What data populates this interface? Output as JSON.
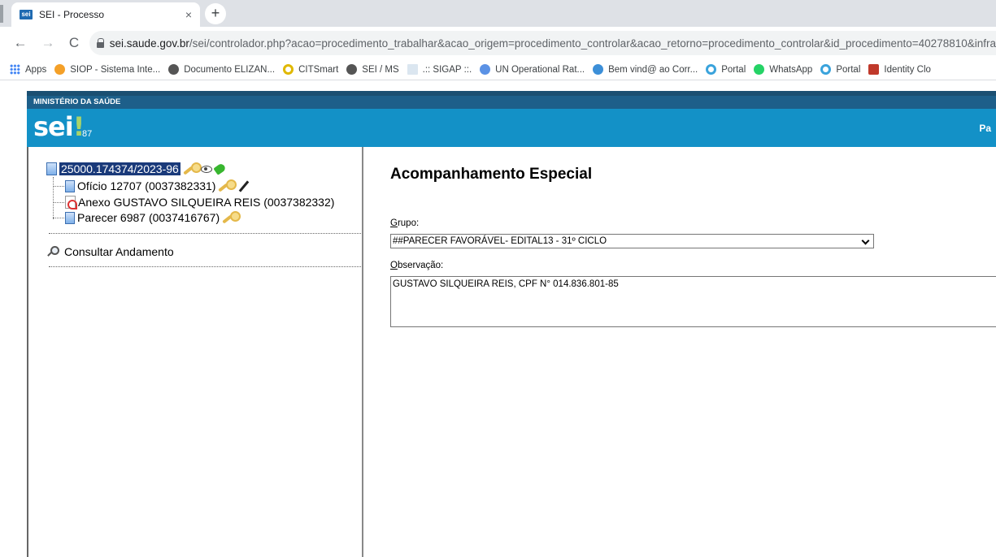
{
  "browser": {
    "tab_title": "SEI - Processo",
    "tab_favicon_text": "sei",
    "tab_close": "×",
    "new_tab": "+",
    "url_host": "sei.saude.gov.br",
    "url_path": "/sei/controlador.php?acao=procedimento_trabalhar&acao_origem=procedimento_controlar&acao_retorno=procedimento_controlar&id_procedimento=40278810&infra",
    "nav_back": "←",
    "nav_forward": "→",
    "nav_reload": "C"
  },
  "bookmarks": [
    {
      "label": "Apps",
      "color": "#4285f4"
    },
    {
      "label": "SIOP - Sistema Inte...",
      "color": "#f4a028"
    },
    {
      "label": "Documento ELIZAN...",
      "color": "#555555"
    },
    {
      "label": "CITSmart",
      "color": "#e0b800"
    },
    {
      "label": "SEI / MS",
      "color": "#555555"
    },
    {
      "label": ".:: SIGAP ::.",
      "color": "#9ab3cc"
    },
    {
      "label": "UN Operational Rat...",
      "color": "#5b92e5"
    },
    {
      "label": "Bem vind@ ao Corr...",
      "color": "#3c8fd8"
    },
    {
      "label": "Portal",
      "color": "#3aa3dc"
    },
    {
      "label": "WhatsApp",
      "color": "#25d366"
    },
    {
      "label": "Portal",
      "color": "#3aa3dc"
    },
    {
      "label": "Identity Clo",
      "color": "#c0392b"
    }
  ],
  "sei": {
    "ministry": "MINISTÉRIO DA SAÚDE",
    "logo_text": "sei",
    "logo_excl": "!",
    "version": "87",
    "right_text": "Pa"
  },
  "tree": {
    "root_number": "25000.174374/2023-96",
    "items": [
      {
        "label": "Ofício 12707 (0037382331)"
      },
      {
        "label": "Anexo GUSTAVO SILQUEIRA REIS (0037382332)"
      },
      {
        "label": "Parecer 6987 (0037416767)"
      }
    ],
    "consult_label": "Consultar Andamento"
  },
  "form": {
    "title": "Acompanhamento Especial",
    "group_label_access": "G",
    "group_label_rest": "rupo:",
    "group_value": "##PARECER FAVORÁVEL- EDITAL13 - 31º CICLO",
    "obs_label_access": "O",
    "obs_label_rest": "bservação:",
    "obs_value": "GUSTAVO SILQUEIRA REIS, CPF N° 014.836.801-85"
  },
  "colors": {
    "sei_header": "#1391c7",
    "sei_ministry_bar": "#1d5f8a",
    "root_highlight": "#1a3a7a"
  }
}
